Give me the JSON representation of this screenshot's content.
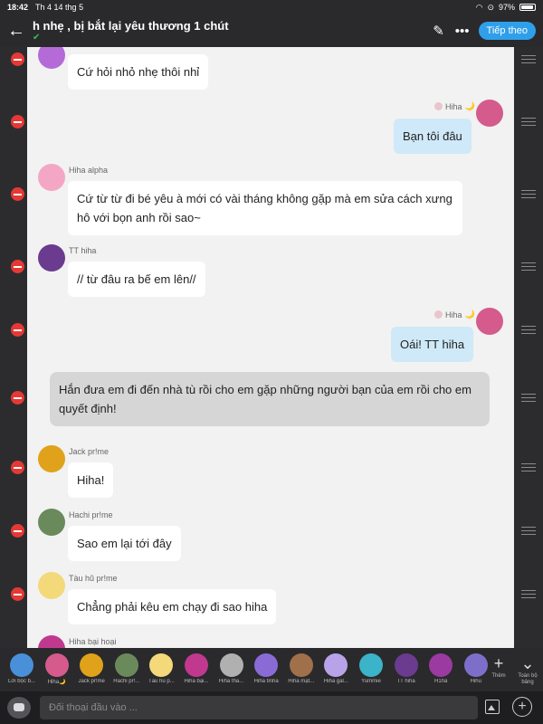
{
  "status": {
    "time": "18:42",
    "date": "Th 4 14 thg 5",
    "battery": "97%"
  },
  "header": {
    "title": "h nhẹ , bị bắt lại yêu thương 1 chút",
    "next_label": "Tiếp theo",
    "icons": [
      "back-arrow-icon",
      "pencil-icon",
      "more-icon"
    ]
  },
  "messages": [
    {
      "id": "m1",
      "speaker": "",
      "text": "Cứ hỏi nhỏ nhẹ thôi nhỉ",
      "avatar_color": "#b46bd8"
    },
    {
      "id": "m2",
      "speaker": "Hiha",
      "mine": true,
      "emoji": "🌙",
      "text": "Bạn tôi đâu",
      "avatar_color": "#d45b8c"
    },
    {
      "id": "m3",
      "speaker": "Hiha alpha",
      "text": "Cứ từ từ đi bé yêu à mới có vài tháng không gặp mà em sửa cách xưng hô với bọn anh rồi sao~",
      "avatar_color": "#f4a7c4"
    },
    {
      "id": "m4",
      "speaker": "TT hiha",
      "text": "// từ đâu ra bế em lên//",
      "avatar_color": "#6a3b8f"
    },
    {
      "id": "m5",
      "speaker": "Hiha",
      "mine": true,
      "emoji": "🌙",
      "text": "Oái! TT hiha",
      "avatar_color": "#d45b8c"
    },
    {
      "id": "m6",
      "speaker": "narration",
      "text": "Hắn đưa em đi đến nhà tù rồi cho em gặp những người bạn của em rồi cho em quyết định!"
    },
    {
      "id": "m7",
      "speaker": "Jack pr!me",
      "text": "Hiha!",
      "avatar_color": "#e0a21a"
    },
    {
      "id": "m8",
      "speaker": "Hachi pr!me",
      "text": "Sao em lại tới đây",
      "avatar_color": "#6b8a5c"
    },
    {
      "id": "m9",
      "speaker": "Tàu hũ pr!me",
      "text": "Chẳng phải kêu em  chạy đi sao hiha",
      "avatar_color": "#f3d97a"
    },
    {
      "id": "m10",
      "speaker": "Hiha bại hoại",
      "text": "",
      "avatar_color": "#c0398f"
    }
  ],
  "characters": [
    {
      "label": "Lời bộc b...",
      "color": "#4a90d9"
    },
    {
      "label": "Hiha🌙",
      "color": "#d45b8c"
    },
    {
      "label": "Jack pr!me",
      "color": "#e0a21a"
    },
    {
      "label": "Hachi pr!...",
      "color": "#6b8a5c"
    },
    {
      "label": "Tàu hũ p...",
      "color": "#f3d97a"
    },
    {
      "label": "Hiha bại...",
      "color": "#c0398f"
    },
    {
      "label": "Hiha tha...",
      "color": "#b0b0b0"
    },
    {
      "label": "Hiha tinha",
      "color": "#8a6bd6"
    },
    {
      "label": "Hiha mặt...",
      "color": "#a0704a"
    },
    {
      "label": "Hiha gal...",
      "color": "#b9a3e8"
    },
    {
      "label": "Yummie",
      "color": "#3bb3c9"
    },
    {
      "label": "TT hiha",
      "color": "#6a3b8f"
    },
    {
      "label": "H1hâ",
      "color": "#9b3aa0"
    },
    {
      "label": "Hihu",
      "color": "#7d6fc9"
    }
  ],
  "tools": {
    "add_label": "Thêm",
    "collapse_label": "Toàn bộ bảng"
  },
  "input": {
    "placeholder": "Đối thoại đầu vào ..."
  }
}
